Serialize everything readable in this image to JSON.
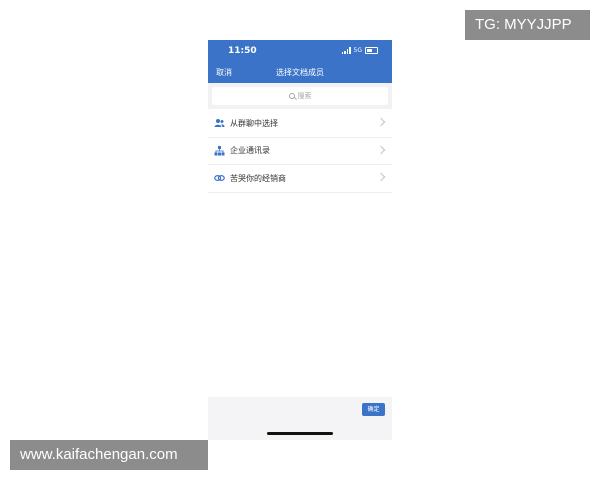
{
  "watermarks": {
    "top_right": "TG: MYYJJPP",
    "bottom_left": "www.kaifachengan.com"
  },
  "status_bar": {
    "time": "11:50",
    "network": "5G"
  },
  "nav": {
    "cancel_label": "取消",
    "title": "选择文档成员"
  },
  "search": {
    "placeholder": "搜索"
  },
  "list": {
    "items": [
      {
        "label": "从群聊中选择",
        "icon": "group-icon"
      },
      {
        "label": "企业通讯录",
        "icon": "org-chart-icon"
      },
      {
        "label": "苦哭你的经销商",
        "icon": "link-icon"
      }
    ]
  },
  "footer": {
    "confirm_label": "确定"
  },
  "colors": {
    "primary": "#3b73c8",
    "background": "#ffffff",
    "search_bg": "#f2f2f4"
  }
}
